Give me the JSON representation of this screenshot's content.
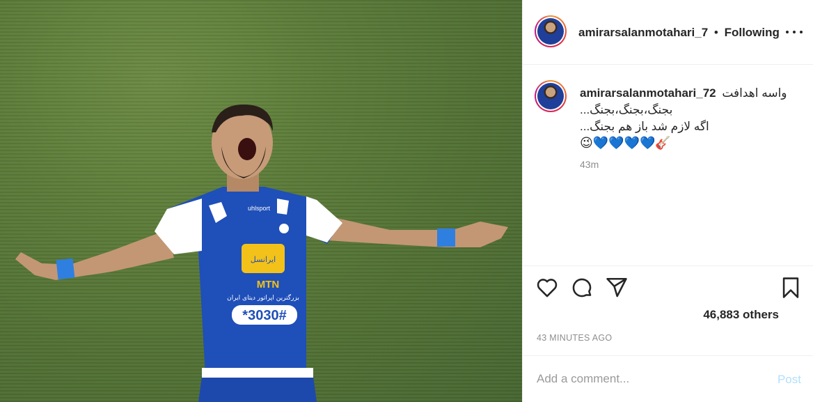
{
  "post": {
    "author": "amirarsalanmotahari_7",
    "follow_separator": "•",
    "follow_status": "Following",
    "photo_alt": "photo-of-player-celebrating"
  },
  "caption": {
    "author": "amirarsalanmotahari_72",
    "lines": [
      "واسه اهدافت",
      "...بجنگ،بجنگ،بجنگ",
      "...اگه لازم شد باز هم بجنگ",
      "😉💙💙💙💙🎸"
    ],
    "time_ago": "43m"
  },
  "jersey": {
    "sponsor_top": "ایرانسل",
    "sponsor_mtn": "MTN",
    "sponsor_sub": "بزرگترین اپراتور دیتای ایران",
    "sponsor_code": "*3030#",
    "brand": "uhlsport"
  },
  "stats": {
    "likes": "46,883 others",
    "timestamp": "43 MINUTES AGO"
  },
  "comment": {
    "placeholder": "Add a comment...",
    "post_label": "Post"
  },
  "colors": {
    "accent_blue": "#0095f6",
    "post_disabled": "#b2dffc",
    "text": "#262626",
    "muted": "#8e8e8e",
    "jersey_blue": "#1f4fb8",
    "pitch_green": "#5a7a38"
  }
}
